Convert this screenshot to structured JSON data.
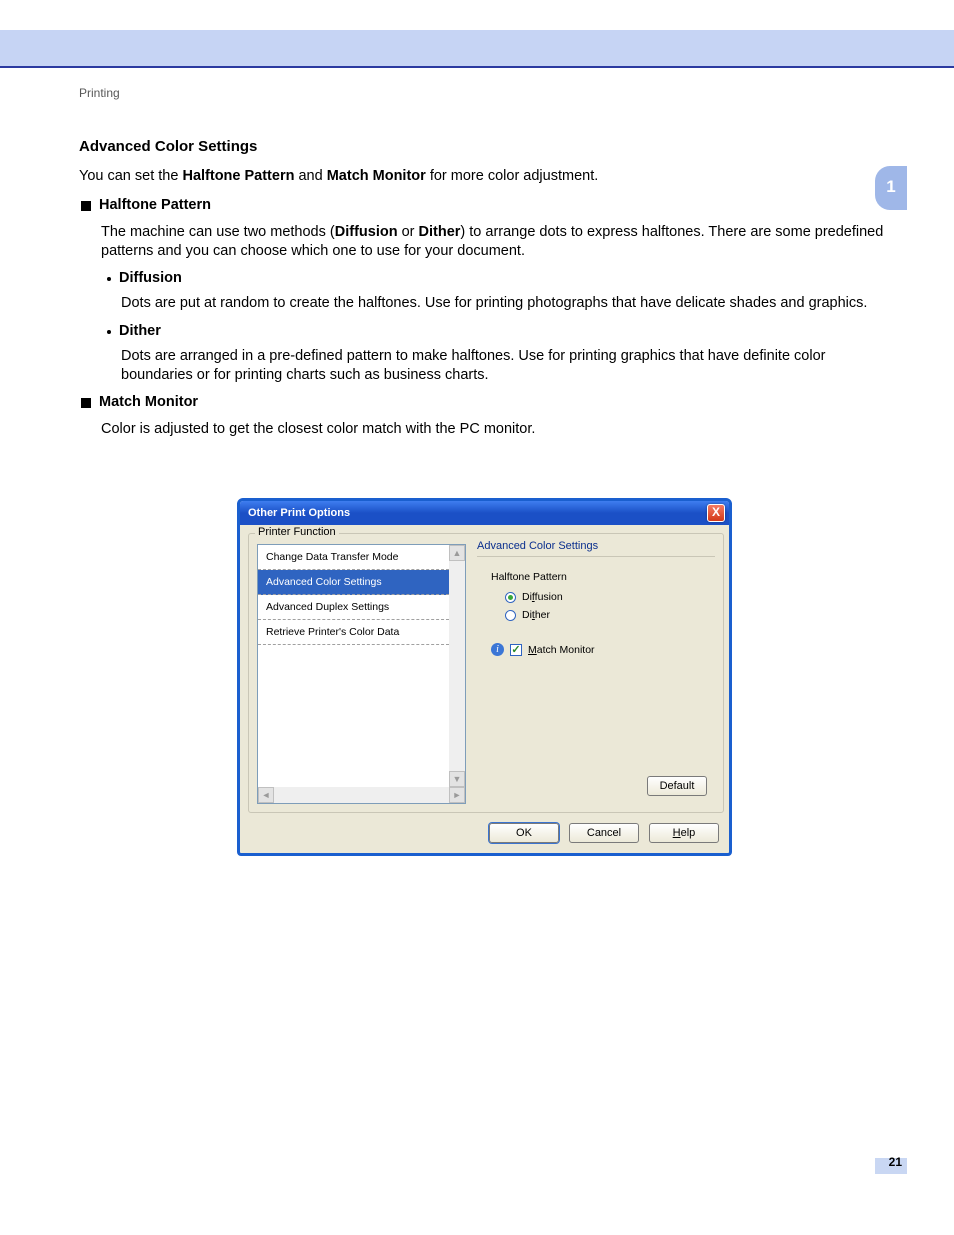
{
  "page": {
    "breadcrumb": "Printing",
    "number": "21",
    "chapter": "1"
  },
  "doc": {
    "title": "Advanced Color Settings",
    "intro_pre": "You can set the ",
    "intro_b1": "Halftone Pattern",
    "intro_mid": " and ",
    "intro_b2": "Match Monitor",
    "intro_post": " for more color adjustment.",
    "sec1": {
      "title": "Halftone Pattern",
      "para_pre": "The machine can use two methods (",
      "para_b1": "Diffusion",
      "para_mid": " or ",
      "para_b2": "Dither",
      "para_post": ") to arrange dots to express halftones. There are some predefined patterns and you can choose which one to use for your document.",
      "b1_title": "Diffusion",
      "b1_para": "Dots are put at random to create the halftones. Use for printing photographs that have delicate shades and graphics.",
      "b2_title": "Dither",
      "b2_para": "Dots are arranged in a pre-defined pattern to make halftones. Use for printing graphics that have definite color boundaries or for printing charts such as business charts."
    },
    "sec2": {
      "title": "Match Monitor",
      "para": "Color is adjusted to get the closest color match with the PC monitor."
    }
  },
  "dialog": {
    "title": "Other Print Options",
    "close": "X",
    "group_label": "Printer Function",
    "list": {
      "item0": "Change Data Transfer Mode",
      "item1": "Advanced Color Settings",
      "item2": "Advanced Duplex Settings",
      "item3": "Retrieve Printer's Color Data"
    },
    "right": {
      "title": "Advanced Color Settings",
      "halftone_label": "Halftone Pattern",
      "radio_diffusion_pre": "Di",
      "radio_diffusion_u": "f",
      "radio_diffusion_post": "fusion",
      "radio_dither_pre": "Di",
      "radio_dither_u": "t",
      "radio_dither_post": "her",
      "match_u": "M",
      "match_post": "atch Monitor"
    },
    "buttons": {
      "default": "Default",
      "ok": "OK",
      "cancel": "Cancel",
      "help_u": "H",
      "help_post": "elp"
    }
  }
}
